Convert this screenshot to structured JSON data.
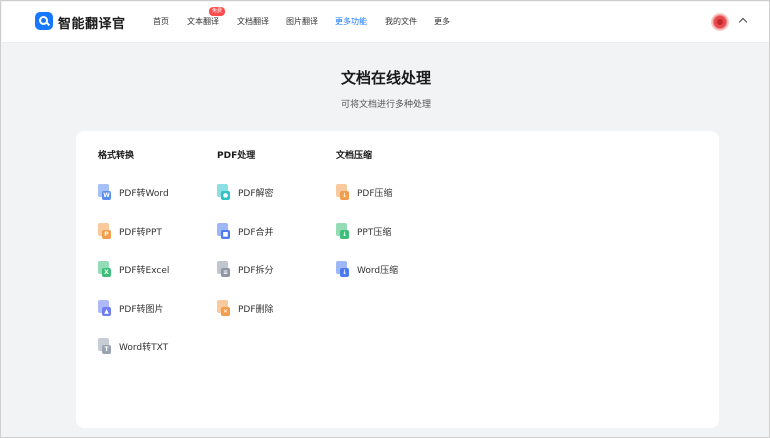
{
  "header": {
    "brand": "智能翻译官",
    "nav": [
      {
        "label": "首页",
        "active": false
      },
      {
        "label": "文本翻译",
        "active": false,
        "badge": "免费"
      },
      {
        "label": "文档翻译",
        "active": false
      },
      {
        "label": "图片翻译",
        "active": false
      },
      {
        "label": "更多功能",
        "active": true
      },
      {
        "label": "我的文件",
        "active": false
      },
      {
        "label": "更多",
        "active": false
      }
    ]
  },
  "main": {
    "title": "文档在线处理",
    "subtitle": "可将文档进行多种处理"
  },
  "columns": [
    {
      "title": "格式转换",
      "items": [
        {
          "label": "PDF转Word",
          "icon": "pdf-to-word-icon",
          "color": "#5b8def",
          "tag": "W"
        },
        {
          "label": "PDF转PPT",
          "icon": "pdf-to-ppt-icon",
          "color": "#f29e4c",
          "tag": "P"
        },
        {
          "label": "PDF转Excel",
          "icon": "pdf-to-excel-icon",
          "color": "#3dbf7a",
          "tag": "X"
        },
        {
          "label": "PDF转图片",
          "icon": "pdf-to-image-icon",
          "color": "#6f7ff2",
          "tag": "▲"
        },
        {
          "label": "Word转TXT",
          "icon": "word-to-txt-icon",
          "color": "#9aa3b2",
          "tag": "T"
        }
      ]
    },
    {
      "title": "PDF处理",
      "items": [
        {
          "label": "PDF解密",
          "icon": "pdf-decrypt-icon",
          "color": "#2ec4c6",
          "tag": "●"
        },
        {
          "label": "PDF合并",
          "icon": "pdf-merge-icon",
          "color": "#4e7bf0",
          "tag": "■"
        },
        {
          "label": "PDF拆分",
          "icon": "pdf-split-icon",
          "color": "#8e96a6",
          "tag": "≡"
        },
        {
          "label": "PDF删除",
          "icon": "pdf-delete-icon",
          "color": "#f29e4c",
          "tag": "✕"
        }
      ]
    },
    {
      "title": "文档压缩",
      "items": [
        {
          "label": "PDF压缩",
          "icon": "pdf-compress-icon",
          "color": "#f29e4c",
          "tag": "↓"
        },
        {
          "label": "PPT压缩",
          "icon": "ppt-compress-icon",
          "color": "#3dbf7a",
          "tag": "↓"
        },
        {
          "label": "Word压缩",
          "icon": "word-compress-icon",
          "color": "#4e7bf0",
          "tag": "↓"
        }
      ]
    }
  ]
}
